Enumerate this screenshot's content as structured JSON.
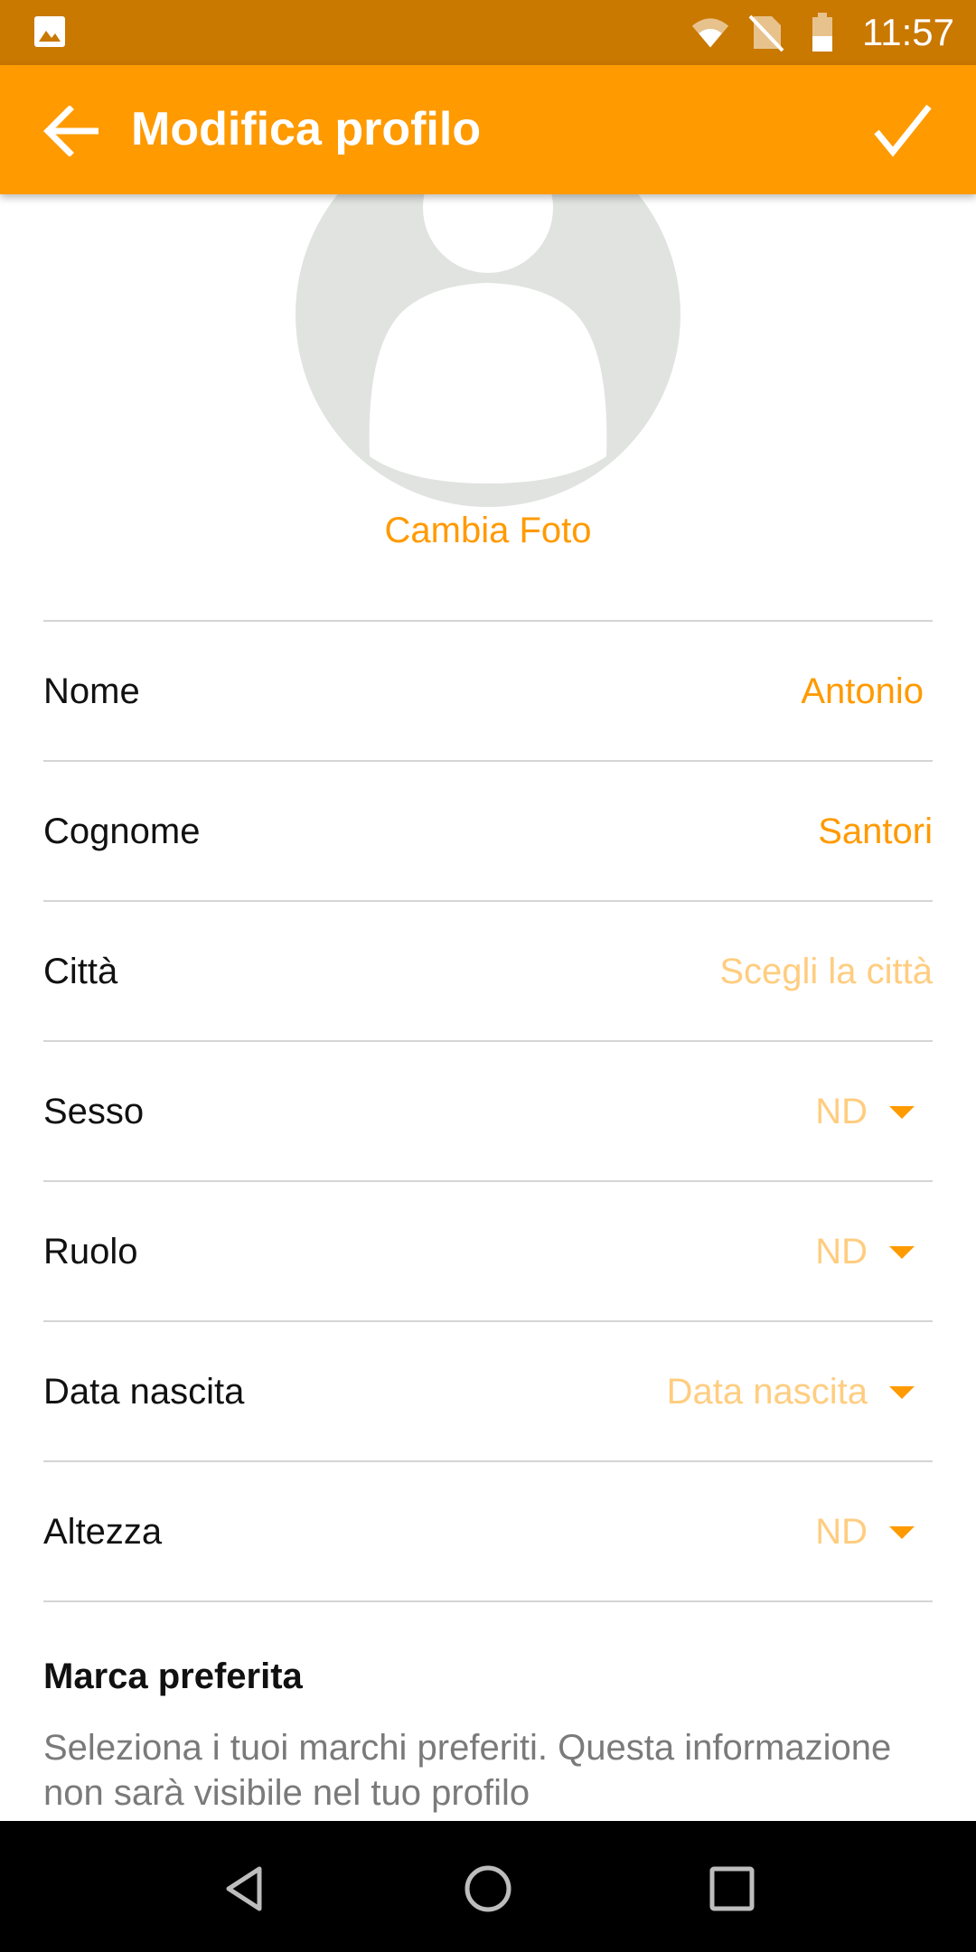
{
  "status_bar": {
    "time": "11:57",
    "icons": [
      "image-notification-icon",
      "wifi-icon",
      "no-sim-icon",
      "battery-icon"
    ],
    "color": "#C97800"
  },
  "app_bar": {
    "title": "Modifica profilo",
    "back_icon": "arrow-back-icon",
    "confirm_icon": "check-icon",
    "color": "#FF9A00"
  },
  "profile": {
    "avatar_icon": "person-placeholder-icon",
    "change_photo_label": "Cambia Foto"
  },
  "fields": [
    {
      "label": "Nome",
      "value": "Antonio",
      "state": "filled"
    },
    {
      "label": "Cognome",
      "value": "Santori",
      "state": "filled"
    },
    {
      "label": "Città",
      "value": "Scegli la città",
      "state": "placeholder"
    },
    {
      "label": "Sesso",
      "value": "ND",
      "state": "dropdown"
    },
    {
      "label": "Ruolo",
      "value": "ND",
      "state": "dropdown"
    },
    {
      "label": "Data nascita",
      "value": "Data nascita",
      "state": "dropdown"
    },
    {
      "label": "Altezza",
      "value": "ND",
      "state": "dropdown"
    }
  ],
  "brand": {
    "title": "Marca preferita",
    "description": "Seleziona i tuoi marchi preferiti. Questa informazione non sarà visibile nel tuo profilo"
  },
  "nav_bar": {
    "icons": [
      "nav-back-icon",
      "nav-home-icon",
      "nav-recents-icon"
    ]
  },
  "colors": {
    "accent": "#FF9A00",
    "placeholder": "#FFCD80",
    "divider": "#D5D5D5"
  }
}
